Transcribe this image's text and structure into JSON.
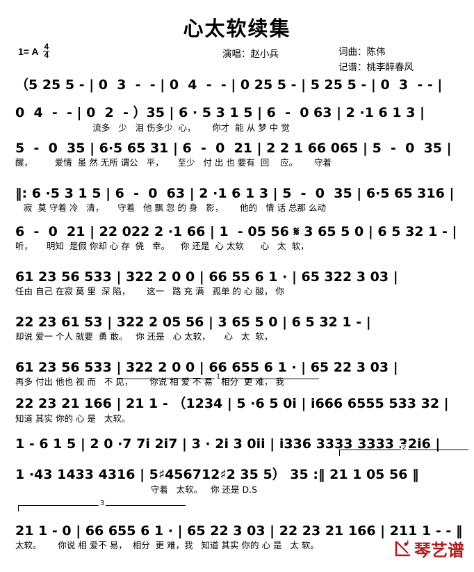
{
  "header": {
    "title": "心太软续集",
    "key_signature": "1= A",
    "meter_numerator": "4",
    "meter_denominator": "4",
    "singer": "演唱：赵小兵",
    "writer": "词曲：陈伟",
    "notator": "记谱：桃李醉春风"
  },
  "logo": {
    "mark": "⌐",
    "text": "琴艺谱",
    "color": "#b01c20"
  },
  "score": {
    "type": "jianpu",
    "lines": [
      {
        "id": "line-1",
        "notes": "（5 25 5 - | 0  3  -  - | 0  4  -  - | 0 25 5 - | 5 25 5 - | 0  3  - - |",
        "lyrics": ""
      },
      {
        "id": "line-2",
        "notes": "0  4  -  - | 0  2  - ）35 | 6 · 5 3 1 5 | 6  -  0 63 | 2 ·1 6 1 3 |",
        "lyrics": "                            流多   少   泪 伤多少  心，      你才  能 从 梦 中 觉"
      },
      {
        "id": "line-3",
        "notes": "5  -  0  35 | 6·5 65 31 | 6  -  0  21 | 2 2 1 66 065 | 5  -  0  35 |",
        "lyrics": "醒，        爱情  虽 然 无所 谓公   平，     至少   付 出 也 要有  回    应。      守着"
      },
      {
        "id": "line-4",
        "notes": "‖: 6 ·5 3 1 5 | 6  -  0  63 | 2 ·1 6 1 3 | 5  -  0  35 | 6·5 65 316 |",
        "lyrics": "   寂  莫 守着 冷   清，     守着   他 飘 忽 的 身   影，      他的   情 话 总那 么动"
      },
      {
        "id": "line-5",
        "notes": "6  -  0  21 | 22 022 2 ·1 66 | 1  - 05 56 𝄋 3 65 5 0 | 6 5 32 1 - |",
        "lyrics": "听，     明知  是假 你却 心 存  侥   幸。    你 还是  心 太软      心   太  软，"
      },
      {
        "id": "line-6",
        "notes": "61 23 56 533 | 322 2 0 0 | 66 55 6 1 · | 65 322 3 03 |",
        "lyrics": "任由 自己 在寂 莫 里  深 陷，      这一   路 充 满   孤单 的 心 酸， 你"
      },
      {
        "id": "line-7",
        "notes": "22 23 61 53 | 322 2 05 56 | 3 65 5 0 | 6 5 32 1 - |",
        "lyrics": "却说 爱一 个人 就要  勇 敢。   你 还是   心 太软，     心   太  软，"
      },
      {
        "id": "line-8",
        "notes": "61 23 56 533 | 322 2 0 0 | 66 655 6 1 · | 65 22 3 03 |",
        "lyrics": "再多 付出 他也 视 而   不 见，      你说 相 爱 不 易   相分  更 难， 我"
      },
      {
        "id": "line-9",
        "notes": "22 23 21 166 | 21 1 - （1234 | 5 ·6 5 0i | i666 6555 533 32 |",
        "lyrics": "知道 其实 你的 心 是   太软。",
        "volta": "1"
      },
      {
        "id": "line-10",
        "notes": "1 - 6 1 5 | 2 0 ·7 7i 2i7 | 3 · 2i 3 0ii | i336 3333 3333 32i6 |",
        "lyrics": ""
      },
      {
        "id": "line-11",
        "notes": "1 ·43 1433 4316 | 5♯456712♯2 35 5） 35 :‖ 21 1 05 56 ‖",
        "lyrics": "                                                 守着   太软。   你 还是 D.S",
        "volta": "2"
      },
      {
        "id": "line-12",
        "notes": "21 1 - 0 | 66 655 6 1 · | 65 22 3 03 | 22 23 21 166 | 211 1 - - ‖",
        "lyrics": "太软。      你说 相 爱不 易，  相分  更 难，我   知道 其实 你的 心 是   太 软。",
        "volta": "3"
      }
    ]
  }
}
